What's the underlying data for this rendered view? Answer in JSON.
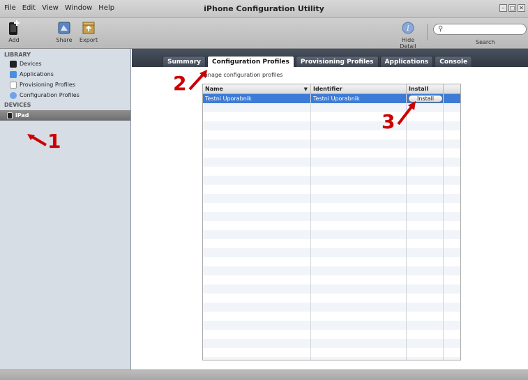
{
  "window": {
    "title": "iPhone Configuration Utility",
    "controls": [
      "minimize-icon",
      "maximize-icon",
      "close-icon"
    ]
  },
  "menu": [
    "File",
    "Edit",
    "View",
    "Window",
    "Help"
  ],
  "toolbar": {
    "add_label": "Add",
    "share_label": "Share",
    "export_label": "Export",
    "hide_detail_label": "Hide Detail",
    "search_label": "Search",
    "search_placeholder": ""
  },
  "sidebar": {
    "library_heading": "LIBRARY",
    "library_items": [
      {
        "label": "Devices",
        "icon": "device-icon"
      },
      {
        "label": "Applications",
        "icon": "applications-icon"
      },
      {
        "label": "Provisioning Profiles",
        "icon": "provisioning-profile-icon"
      },
      {
        "label": "Configuration Profiles",
        "icon": "configuration-profile-icon"
      }
    ],
    "devices_heading": "DEVICES",
    "device_items": [
      {
        "label": "iPad",
        "icon": "ipad-icon",
        "selected": true
      }
    ]
  },
  "tabs": [
    {
      "label": "Summary",
      "active": false
    },
    {
      "label": "Configuration Profiles",
      "active": true
    },
    {
      "label": "Provisioning Profiles",
      "active": false
    },
    {
      "label": "Applications",
      "active": false
    },
    {
      "label": "Console",
      "active": false
    }
  ],
  "main": {
    "manage_label": "anage configuration profiles"
  },
  "table": {
    "columns": [
      "Name",
      "Identifier",
      "Install",
      ""
    ],
    "rows": [
      {
        "name": "Testni Uporabnik",
        "identifier": "Testni Uporabnik",
        "install_label": "Install"
      }
    ],
    "empty_row_count": 29
  },
  "annotations": [
    "1",
    "2",
    "3"
  ],
  "colors": {
    "selection": "#3d7bd6",
    "header_dark": "#3a414c",
    "sidebar_bg": "#d6dde5",
    "annotation_red": "#cc0000"
  }
}
